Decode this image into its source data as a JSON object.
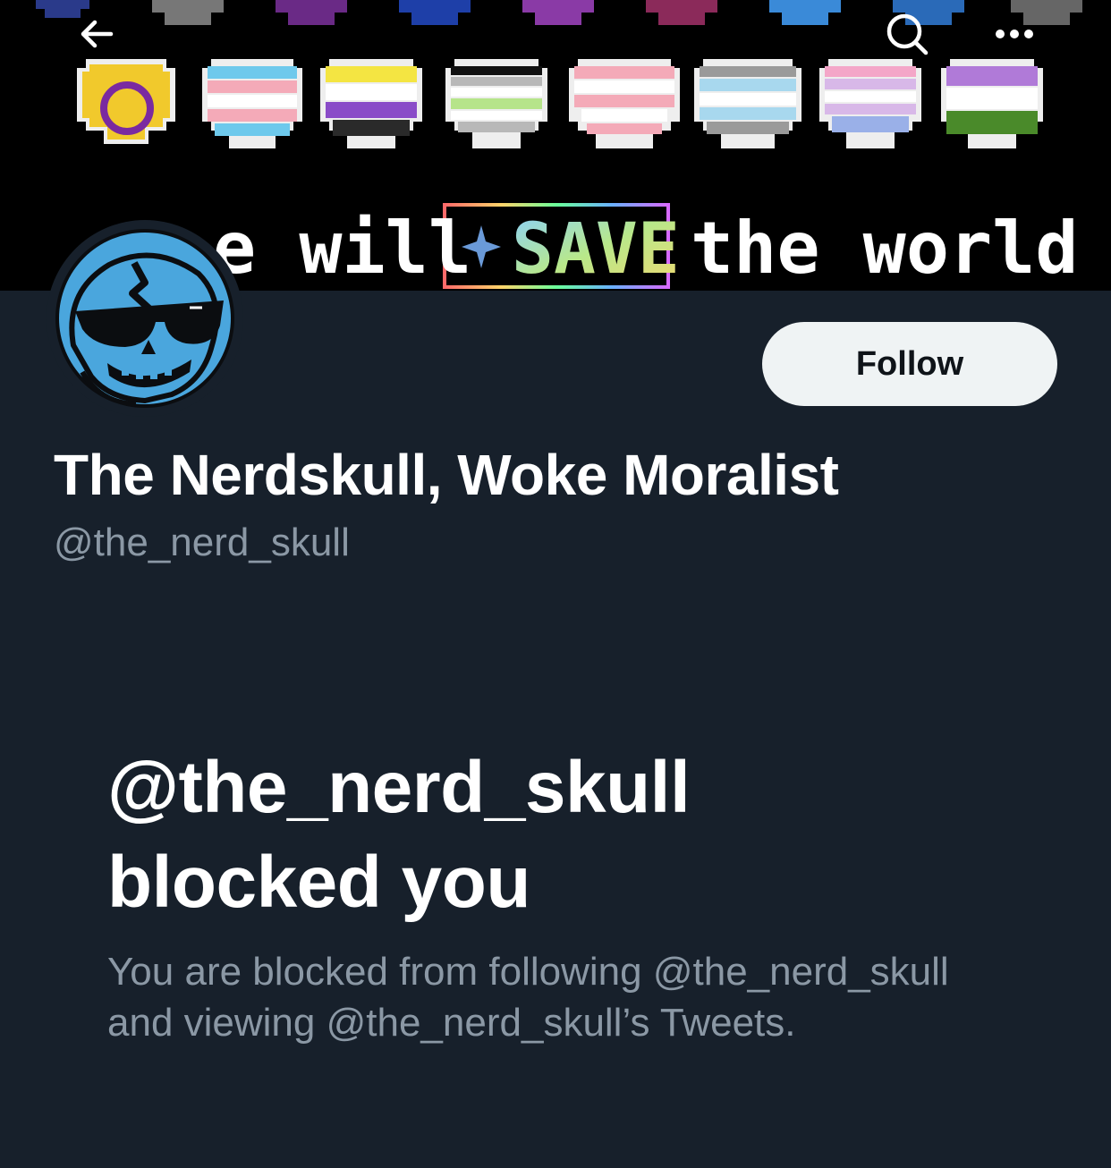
{
  "colors": {
    "background": "#17202b",
    "banner_background": "#000000",
    "primary_text": "#ffffff",
    "secondary_text": "#8b98a5",
    "follow_button_bg": "#eff3f4",
    "follow_button_text": "#0f1419",
    "avatar_blue": "#4aa6dd"
  },
  "header": {
    "back_icon": "arrow-left-icon",
    "search_icon": "search-icon",
    "more_icon": "more-dots-icon"
  },
  "banner": {
    "text_left": "e will",
    "text_highlight": "SAVE",
    "text_right": "the world",
    "hearts": [
      "intersex",
      "transgender",
      "nonbinary",
      "agender",
      "trans",
      "demiboy",
      "genderfluid",
      "genderqueer"
    ]
  },
  "profile": {
    "avatar_icon": "skull-sunglasses-avatar",
    "follow_label": "Follow",
    "display_name": "The Nerdskull, Woke Moralist",
    "handle": "@the_nerd_skull"
  },
  "blocked": {
    "title_line1": "@the_nerd_skull",
    "title_line2": "blocked you",
    "description": "You are blocked from following @the_nerd_skull and viewing @the_nerd_skull’s Tweets."
  }
}
